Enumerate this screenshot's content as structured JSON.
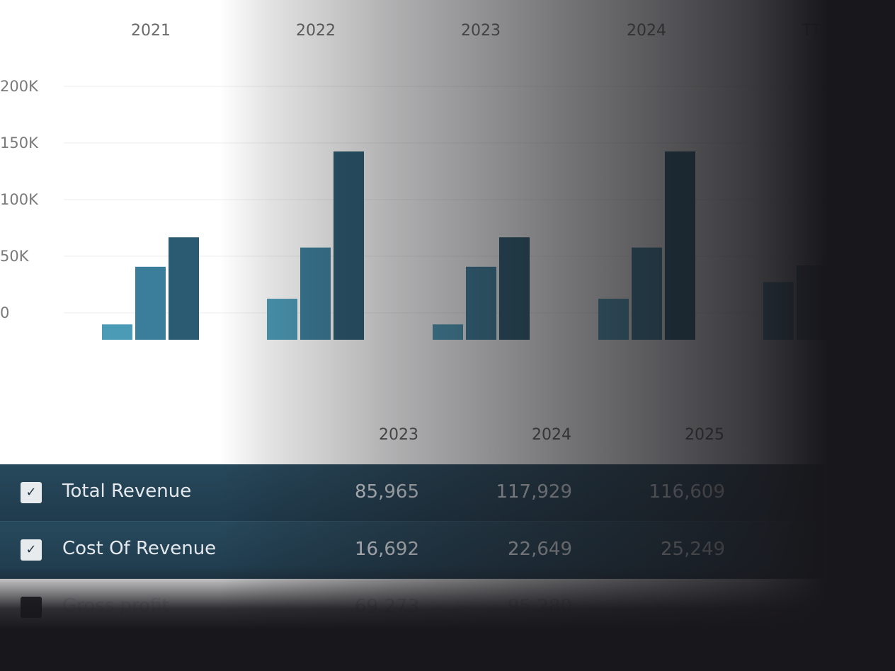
{
  "chart_data": {
    "type": "bar",
    "categories": [
      "2021",
      "2022",
      "2023",
      "2024",
      "TT"
    ],
    "series": [
      {
        "values": [
          12000,
          32000,
          12000,
          32000,
          45000
        ]
      },
      {
        "values": [
          57000,
          72000,
          57000,
          72000,
          58000
        ]
      },
      {
        "values": [
          80000,
          147000,
          80000,
          147000,
          null
        ]
      }
    ],
    "y_ticks": [
      "200K",
      "150K",
      "100K",
      "50K",
      "0"
    ],
    "colors": [
      "#4b9bb7",
      "#3a7e9b",
      "#2a5b72"
    ],
    "grid": true
  },
  "table": {
    "columns": [
      "2023",
      "2024",
      "2025"
    ],
    "rows": [
      {
        "label": "Total Revenue",
        "checked": true,
        "values": [
          "85,965",
          "117,929",
          "116,609"
        ]
      },
      {
        "label": "Cost Of Revenue",
        "checked": true,
        "values": [
          "16,692",
          "22,649",
          "25,249"
        ]
      },
      {
        "label": "Gross profit",
        "checked": false,
        "values": [
          "69,273",
          "95,280",
          ""
        ]
      }
    ],
    "check_glyph": "✓"
  }
}
